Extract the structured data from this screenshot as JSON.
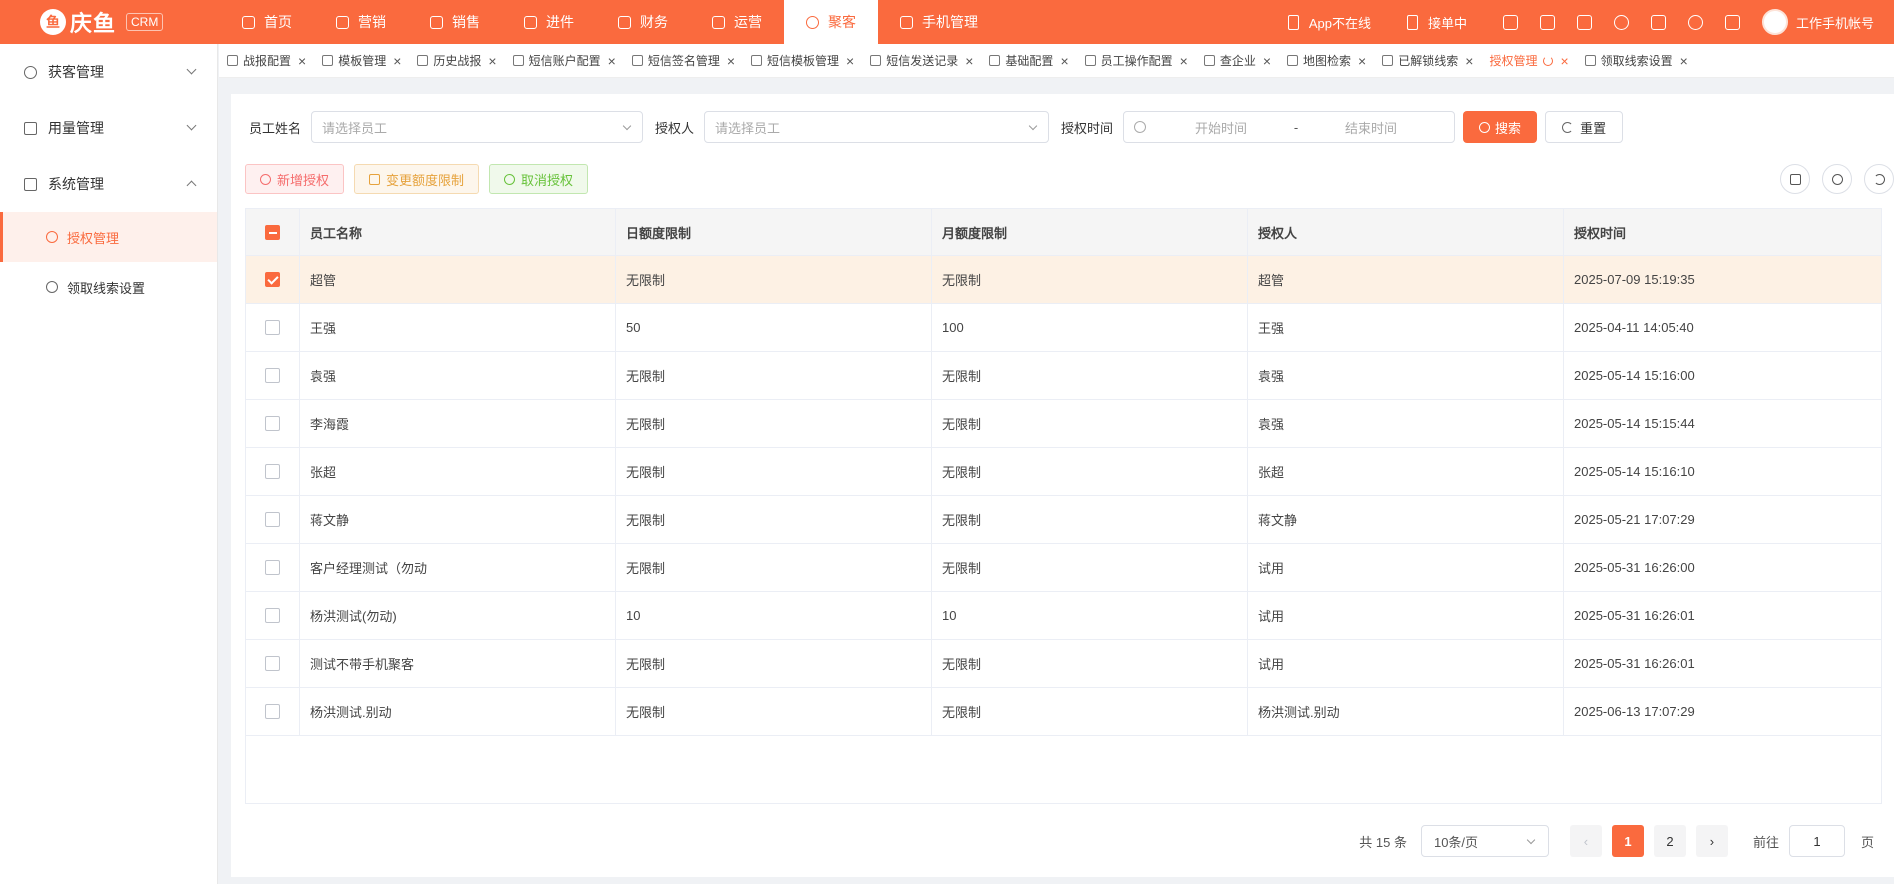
{
  "brand": {
    "logo_mark": "鱼",
    "name": "庆鱼",
    "tag": "CRM"
  },
  "topnav": [
    {
      "label": "首页"
    },
    {
      "label": "营销"
    },
    {
      "label": "销售"
    },
    {
      "label": "进件"
    },
    {
      "label": "财务"
    },
    {
      "label": "运营"
    },
    {
      "label": "聚客",
      "active": true
    },
    {
      "label": "手机管理"
    }
  ],
  "topright": {
    "app_status": "App不在线",
    "order_status": "接单中",
    "user_name": "工作手机帐号"
  },
  "sidebar": {
    "groups": [
      {
        "label": "获客管理",
        "expanded": false
      },
      {
        "label": "用量管理",
        "expanded": false
      },
      {
        "label": "系统管理",
        "expanded": true
      }
    ],
    "subitems": [
      {
        "label": "授权管理",
        "active": true
      },
      {
        "label": "领取线索设置",
        "active": false
      }
    ]
  },
  "tabs": [
    {
      "label": "战报配置"
    },
    {
      "label": "模板管理"
    },
    {
      "label": "历史战报"
    },
    {
      "label": "短信账户配置"
    },
    {
      "label": "短信签名管理"
    },
    {
      "label": "短信模板管理"
    },
    {
      "label": "短信发送记录"
    },
    {
      "label": "基础配置"
    },
    {
      "label": "员工操作配置"
    },
    {
      "label": "查企业"
    },
    {
      "label": "地图检索"
    },
    {
      "label": "已解锁线索"
    },
    {
      "label": "授权管理",
      "active": true
    },
    {
      "label": "领取线索设置"
    }
  ],
  "filters": {
    "employee_label": "员工姓名",
    "employee_placeholder": "请选择员工",
    "grantor_label": "授权人",
    "grantor_placeholder": "请选择员工",
    "time_label": "授权时间",
    "start_placeholder": "开始时间",
    "separator": "-",
    "end_placeholder": "结束时间",
    "search_button": "搜索",
    "reset_button": "重置"
  },
  "actions": {
    "add": "新增授权",
    "change": "变更额度限制",
    "cancel": "取消授权"
  },
  "table": {
    "columns": [
      "员工名称",
      "日额度限制",
      "月额度限制",
      "授权人",
      "授权时间"
    ],
    "rows": [
      [
        "超管",
        "无限制",
        "无限制",
        "超管",
        "2025-07-09 15:19:35"
      ],
      [
        "王强",
        "50",
        "100",
        "王强",
        "2025-04-11 14:05:40"
      ],
      [
        "袁强",
        "无限制",
        "无限制",
        "袁强",
        "2025-05-14 15:16:00"
      ],
      [
        "李海霞",
        "无限制",
        "无限制",
        "袁强",
        "2025-05-14 15:15:44"
      ],
      [
        "张超",
        "无限制",
        "无限制",
        "张超",
        "2025-05-14 15:16:10"
      ],
      [
        "蒋文静",
        "无限制",
        "无限制",
        "蒋文静",
        "2025-05-21 17:07:29"
      ],
      [
        "客户经理测试（勿动",
        "无限制",
        "无限制",
        "试用",
        "2025-05-31 16:26:00"
      ],
      [
        "杨洪测试(勿动)",
        "10",
        "10",
        "试用",
        "2025-05-31 16:26:01"
      ],
      [
        "测试不带手机聚客",
        "无限制",
        "无限制",
        "试用",
        "2025-05-31 16:26:01"
      ],
      [
        "杨洪测试.别动",
        "无限制",
        "无限制",
        "杨洪测试.别动",
        "2025-06-13 17:07:29"
      ]
    ],
    "selected_row": 0
  },
  "pagination": {
    "total": "共 15 条",
    "page_size": "10条/页",
    "prev": "‹",
    "next": "›",
    "pages": [
      "1",
      "2"
    ],
    "current": "1",
    "goto_label": "前往",
    "goto_value": "1",
    "goto_suffix": "页"
  },
  "colors": {
    "accent": "#fa6a3e"
  }
}
